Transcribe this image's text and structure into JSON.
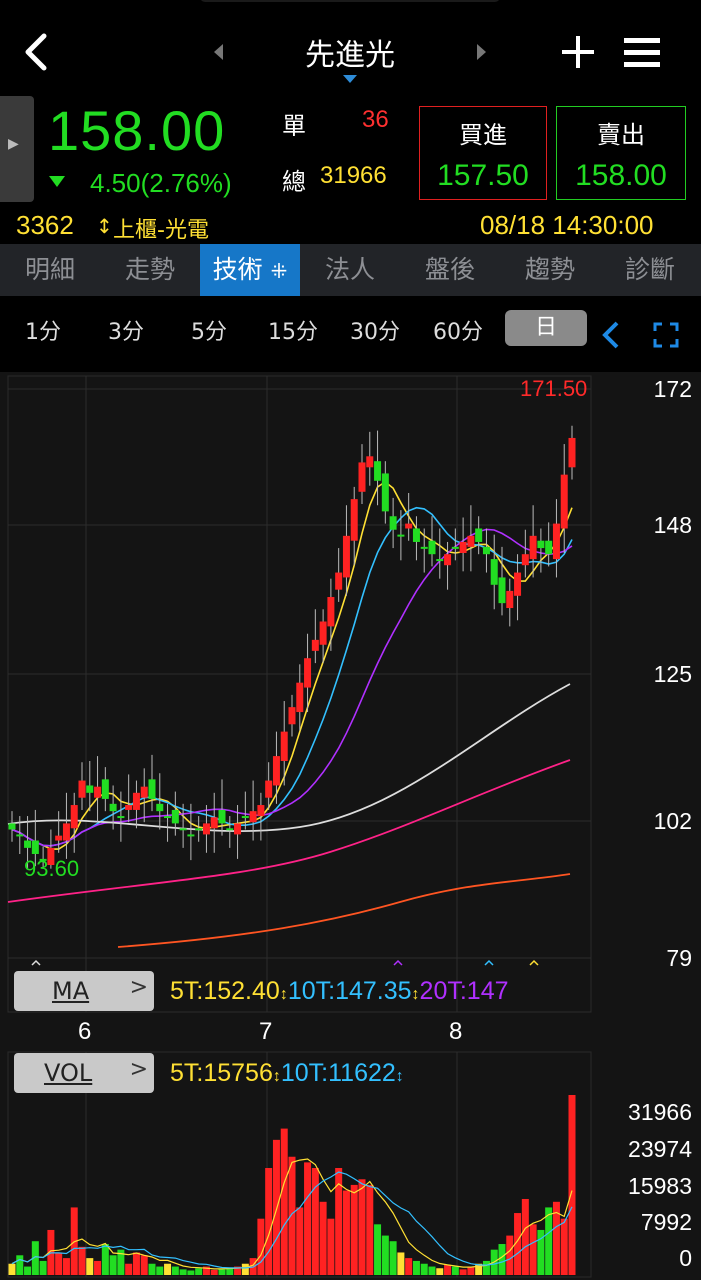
{
  "header": {
    "title": "先進光"
  },
  "quote": {
    "price": "158.00",
    "change": "4.50",
    "change_pct": "(2.76%)",
    "single_label": "單",
    "single_volume": "36",
    "total_label": "總",
    "total_volume": "31966",
    "bid_label": "買進",
    "bid_price": "157.50",
    "ask_label": "賣出",
    "ask_price": "158.00",
    "code": "3362",
    "category": "上櫃-光電",
    "datetime": "08/18 14:30:00"
  },
  "tabs": [
    "明細",
    "走勢",
    "技術",
    "法人",
    "盤後",
    "趨勢",
    "診斷"
  ],
  "active_tab": "技術",
  "periods": [
    "1分",
    "3分",
    "5分",
    "15分",
    "30分",
    "60分",
    "日"
  ],
  "selected_period": "日",
  "price_axis": [
    "172",
    "148",
    "125",
    "102",
    "79"
  ],
  "high_label": "171.50",
  "low_label": "93.60",
  "x_labels": [
    "6",
    "7",
    "8"
  ],
  "ma_indicator": {
    "button": "MA",
    "ma5": "5T:152.40",
    "ma10": "10T:147.35",
    "ma20": "20T:147"
  },
  "vol_indicator": {
    "button": "VOL",
    "v5": "5T:15756",
    "v10": "10T:11622"
  },
  "volume_axis": [
    "31966",
    "23974",
    "15983",
    "7992",
    "0"
  ],
  "colors": {
    "up": "#ff2222",
    "down": "#22dd22",
    "ma5": "#ffe034",
    "ma10": "#33c0ff",
    "ma20": "#b030ff",
    "ma60": "#dddddd",
    "ma120": "#ff2288",
    "ma240": "#ff5522",
    "tab_active": "#1677c8"
  },
  "icons": [
    "back-icon",
    "prev-stock-icon",
    "next-stock-icon",
    "add-icon",
    "menu-icon",
    "expand-icon",
    "collapse-left-icon"
  ]
}
